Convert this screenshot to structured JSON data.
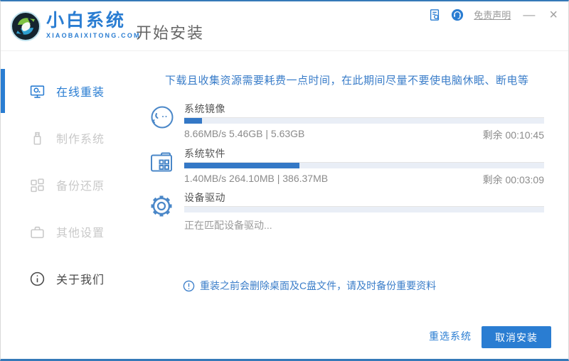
{
  "header": {
    "brand": "小白系统",
    "brand_domain": "XIAOBAIXITONG.COM",
    "page_title": "开始安装",
    "disclaimer_link": "免责声明",
    "minimize_glyph": "—",
    "close_glyph": "×"
  },
  "sidebar": {
    "items": [
      {
        "label": "在线重装",
        "icon": "monitor-icon",
        "state": "active"
      },
      {
        "label": "制作系统",
        "icon": "usb-drive-icon",
        "state": "disabled"
      },
      {
        "label": "备份还原",
        "icon": "backup-grid-icon",
        "state": "disabled"
      },
      {
        "label": "其他设置",
        "icon": "briefcase-icon",
        "state": "disabled"
      },
      {
        "label": "关于我们",
        "icon": "info-icon",
        "state": "normal"
      }
    ]
  },
  "main": {
    "notice": "下载且收集资源需要耗费一点时间，在此期间尽量不要使电脑休眠、断电等",
    "tasks": [
      {
        "name": "系统镜像",
        "icon": "mascot-face-icon",
        "progress_percent": 5,
        "stats": "8.66MB/s 5.46GB | 5.63GB",
        "remaining": "剩余 00:10:45"
      },
      {
        "name": "系统软件",
        "icon": "app-folder-icon",
        "progress_percent": 32,
        "stats": "1.40MB/s 264.10MB | 386.37MB",
        "remaining": "剩余 00:03:09"
      },
      {
        "name": "设备驱动",
        "icon": "gear-icon",
        "progress_percent": 0,
        "status": "正在匹配设备驱动..."
      }
    ],
    "warning": "重装之前会删除桌面及C盘文件，请及时备份重要资料"
  },
  "footer": {
    "reselect_button": "重选系统",
    "cancel_button": "取消安装"
  },
  "colors": {
    "accent_blue": "#2a7dd2",
    "progress_fill": "#3478c6",
    "progress_track": "#e9eef6",
    "notice_text": "#3a7dc9",
    "disabled_text": "#c9c9c9",
    "window_border_blue": "#3579b8"
  }
}
